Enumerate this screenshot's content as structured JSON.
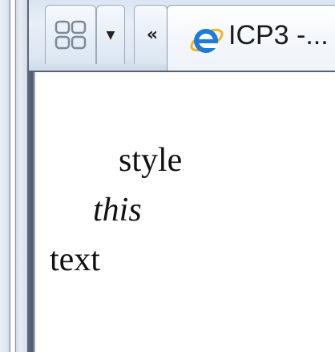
{
  "tabstrip": {
    "quick_tabs_icon": "quick-tabs-grid-icon",
    "tab_list_icon": "chevron-down-icon",
    "back_icon": "double-chevron-left-icon",
    "active_tab": {
      "icon": "internet-explorer-icon",
      "title": "ICP3 -..."
    }
  },
  "content": {
    "line1": "style",
    "line2": "this",
    "line3": "text"
  },
  "colors": {
    "frame_dark": "#566174",
    "tab_gradient_top": "#f6f9fc",
    "tab_gradient_bottom": "#dbe5f1",
    "ie_blue": "#1f7bd6",
    "ie_gold": "#f2b51d"
  }
}
